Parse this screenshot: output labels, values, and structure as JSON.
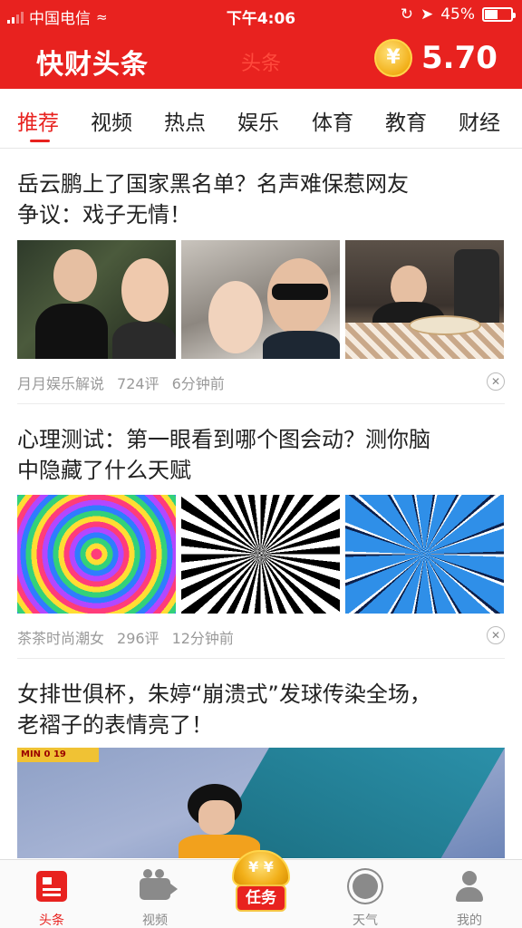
{
  "status_bar": {
    "carrier": "中国电信",
    "time": "下午4:06",
    "battery": "45%",
    "battery_level": 0.45
  },
  "header": {
    "app_name": "快财头条",
    "center_tab": "头条",
    "coin_symbol": "¥",
    "balance": "5.70"
  },
  "categories": [
    {
      "label": "推荐",
      "active": true
    },
    {
      "label": "视频",
      "active": false
    },
    {
      "label": "热点",
      "active": false
    },
    {
      "label": "娱乐",
      "active": false
    },
    {
      "label": "体育",
      "active": false
    },
    {
      "label": "教育",
      "active": false
    },
    {
      "label": "财经",
      "active": false
    }
  ],
  "articles": [
    {
      "title_line1": "岳云鹏上了国家黑名单？名声难保惹网友",
      "title_line2": "争议：戏子无情！",
      "source": "月月娱乐解说",
      "comments": "724评",
      "time": "6分钟前"
    },
    {
      "title_line1": "心理测试：第一眼看到哪个图会动？测你脑",
      "title_line2": "中隐藏了什么天赋",
      "source": "茶茶时尚潮女",
      "comments": "296评",
      "time": "12分钟前"
    },
    {
      "title_line1": "女排世俱杯，朱婷“崩溃式”发球传染全场，",
      "title_line2": "老褶子的表情亮了！",
      "video_score": "MIN  0  19"
    }
  ],
  "bottom_nav": {
    "items": [
      {
        "label": "头条",
        "icon": "headline-icon",
        "active": true
      },
      {
        "label": "视频",
        "icon": "video-camera-icon",
        "active": false
      },
      {
        "label": "任务",
        "icon": "task-coins-icon",
        "active": false
      },
      {
        "label": "天气",
        "icon": "weather-sun-icon",
        "active": false
      },
      {
        "label": "我的",
        "icon": "user-icon",
        "active": false
      }
    ],
    "task_coin_symbol": "¥ ¥"
  },
  "colors": {
    "brand_red": "#e8221f",
    "coin_gold": "#f2b01a",
    "meta_gray": "#999999"
  }
}
